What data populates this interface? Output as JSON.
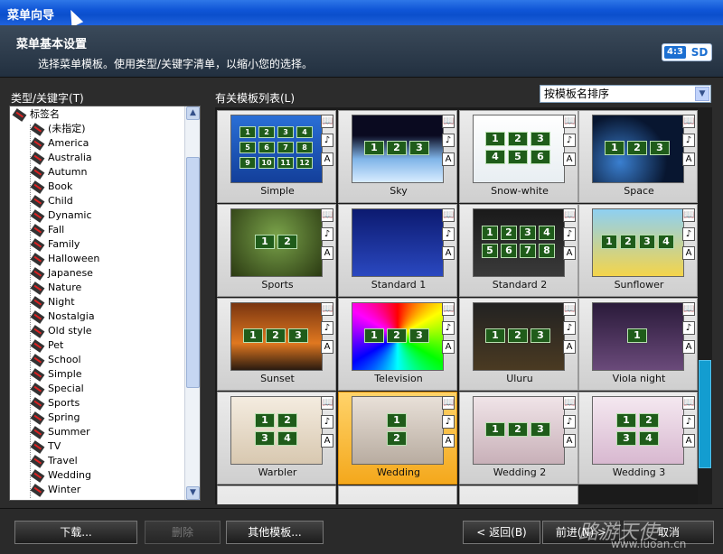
{
  "window": {
    "title": "菜单向导"
  },
  "header": {
    "title": "菜单基本设置",
    "description": "选择菜单模板。使用类型/关键字清单，以缩小您的选择。",
    "badge_ratio": "4:3",
    "badge_format": "SD"
  },
  "left_panel": {
    "label": "类型/关键字(T)",
    "root": "标签名",
    "items": [
      "(未指定)",
      "America",
      "Australia",
      "Autumn",
      "Book",
      "Child",
      "Dynamic",
      "Fall",
      "Family",
      "Halloween",
      "Japanese",
      "Nature",
      "Night",
      "Nostalgia",
      "Old style",
      "Pet",
      "School",
      "Simple",
      "Special",
      "Sports",
      "Spring",
      "Summer",
      "TV",
      "Travel",
      "Wedding",
      "Winter"
    ]
  },
  "right_panel": {
    "label": "有关模板列表(L)",
    "sort_value": "按模板名排序",
    "side_icons": [
      "📖",
      "♪",
      "A"
    ],
    "templates": [
      {
        "name": "Simple",
        "bg": "linear-gradient(#2a6fd6,#133f9a)",
        "nums": [
          "1",
          "2",
          "3",
          "4",
          "5",
          "6",
          "7",
          "8",
          "9",
          "10",
          "11",
          "12"
        ],
        "cols": 4
      },
      {
        "name": "Sky",
        "bg": "linear-gradient(#0a0a20 30%,#7fb4e8 65%,#d8ecff)",
        "nums": [
          "1",
          "2",
          "3"
        ],
        "cols": 3
      },
      {
        "name": "Snow-white",
        "bg": "linear-gradient(#ffffff,#e8eef2)",
        "nums": [
          "1",
          "2",
          "3",
          "4",
          "5",
          "6"
        ],
        "cols": 3
      },
      {
        "name": "Space",
        "bg": "radial-gradient(circle at 30% 70%,#3a7fd0,#081630 60%)",
        "nums": [
          "1",
          "2",
          "3"
        ],
        "cols": 3
      },
      {
        "name": "Sports",
        "bg": "radial-gradient(circle at 50% 40%,#7aa34a,#2b3a12)",
        "nums": [
          "1",
          "2"
        ],
        "cols": 2
      },
      {
        "name": "Standard 1",
        "bg": "linear-gradient(#0c1a70,#2a48c0)",
        "nums": [],
        "cols": 1
      },
      {
        "name": "Standard 2",
        "bg": "linear-gradient(#1a1a1a,#3a3a3a)",
        "nums": [
          "1",
          "2",
          "3",
          "4",
          "5",
          "6",
          "7",
          "8"
        ],
        "cols": 4
      },
      {
        "name": "Sunflower",
        "bg": "linear-gradient(#8ed0f2,#f4d44a)",
        "nums": [
          "1",
          "2",
          "3",
          "4"
        ],
        "cols": 4
      },
      {
        "name": "Sunset",
        "bg": "linear-gradient(#7a3510,#e07820 60%,#2a1a10)",
        "nums": [
          "1",
          "2",
          "3"
        ],
        "cols": 3
      },
      {
        "name": "Television",
        "bg": "conic-gradient(red,yellow,lime,cyan,blue,magenta,red)",
        "nums": [
          "1",
          "2",
          "3"
        ],
        "cols": 3
      },
      {
        "name": "Uluru",
        "bg": "linear-gradient(#222,#4a3a22)",
        "nums": [
          "1",
          "2",
          "3"
        ],
        "cols": 3
      },
      {
        "name": "Viola night",
        "bg": "linear-gradient(#2a1a3a,#6a4a7a)",
        "nums": [
          "1"
        ],
        "cols": 1
      },
      {
        "name": "Warbler",
        "bg": "linear-gradient(#f4ece0,#d8c8b0)",
        "nums": [
          "1",
          "2",
          "3",
          "4"
        ],
        "cols": 2
      },
      {
        "name": "Wedding",
        "bg": "linear-gradient(#e8e0d8,#b8aca0)",
        "nums": [
          "1",
          "2"
        ],
        "cols": 1,
        "selected": true
      },
      {
        "name": "Wedding 2",
        "bg": "linear-gradient(#f0e4e8,#c8b0b8)",
        "nums": [
          "1",
          "2",
          "3"
        ],
        "cols": 3
      },
      {
        "name": "Wedding 3",
        "bg": "linear-gradient(#f4e8f0,#d8b8d0)",
        "nums": [
          "1",
          "2",
          "3",
          "4"
        ],
        "cols": 2
      }
    ]
  },
  "footer": {
    "download": "下载...",
    "delete": "删除",
    "other_templates": "其他模板...",
    "back": "< 返回(B)",
    "next": "前进(N) >",
    "cancel": "取消",
    "watermark": "路游天使",
    "watermark_url": "www.luoan.cn"
  },
  "colors": {
    "accent": "#139dd0",
    "selected": "#f4a81c",
    "button_bg": "#1c1c1c"
  }
}
